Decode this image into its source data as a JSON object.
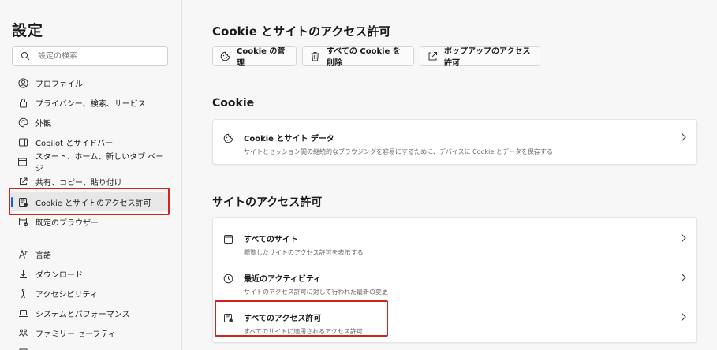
{
  "sidebar": {
    "title": "設定",
    "search_placeholder": "設定の検索",
    "items": [
      {
        "label": "プロファイル"
      },
      {
        "label": "プライバシー、検索、サービス"
      },
      {
        "label": "外観"
      },
      {
        "label": "Copilot とサイドバー"
      },
      {
        "label": "スタート、ホーム、新しいタブ ページ"
      },
      {
        "label": "共有、コピー、貼り付け"
      },
      {
        "label": "Cookie とサイトのアクセス許可"
      },
      {
        "label": "既定のブラウザー"
      },
      {
        "label": "言語"
      },
      {
        "label": "ダウンロード"
      },
      {
        "label": "アクセシビリティ"
      },
      {
        "label": "システムとパフォーマンス"
      },
      {
        "label": "ファミリー セーフティ"
      }
    ]
  },
  "main": {
    "title": "Cookie とサイトのアクセス許可",
    "buttons": {
      "manage": "Cookie の管理",
      "delete_all": "すべての Cookie を削除",
      "popup": "ポップアップのアクセス許可"
    },
    "cookie_section": {
      "heading": "Cookie",
      "row_title": "Cookie とサイト データ",
      "row_sub": "サイトとセッション間の継続的なブラウジングを容易にするために、デバイスに Cookie とデータを保存する"
    },
    "permissions_section": {
      "heading": "サイトのアクセス許可",
      "rows": [
        {
          "title": "すべてのサイト",
          "sub": "閲覧したサイトのアクセス許可を表示する"
        },
        {
          "title": "最近のアクティビティ",
          "sub": "サイトのアクセス許可に対して行われた最新の変更"
        },
        {
          "title": "すべてのアクセス許可",
          "sub": "すべてのサイトに適用されるアクセス許可"
        }
      ]
    }
  },
  "colors": {
    "accent": "#0f6cbd",
    "highlight": "#d42121"
  }
}
